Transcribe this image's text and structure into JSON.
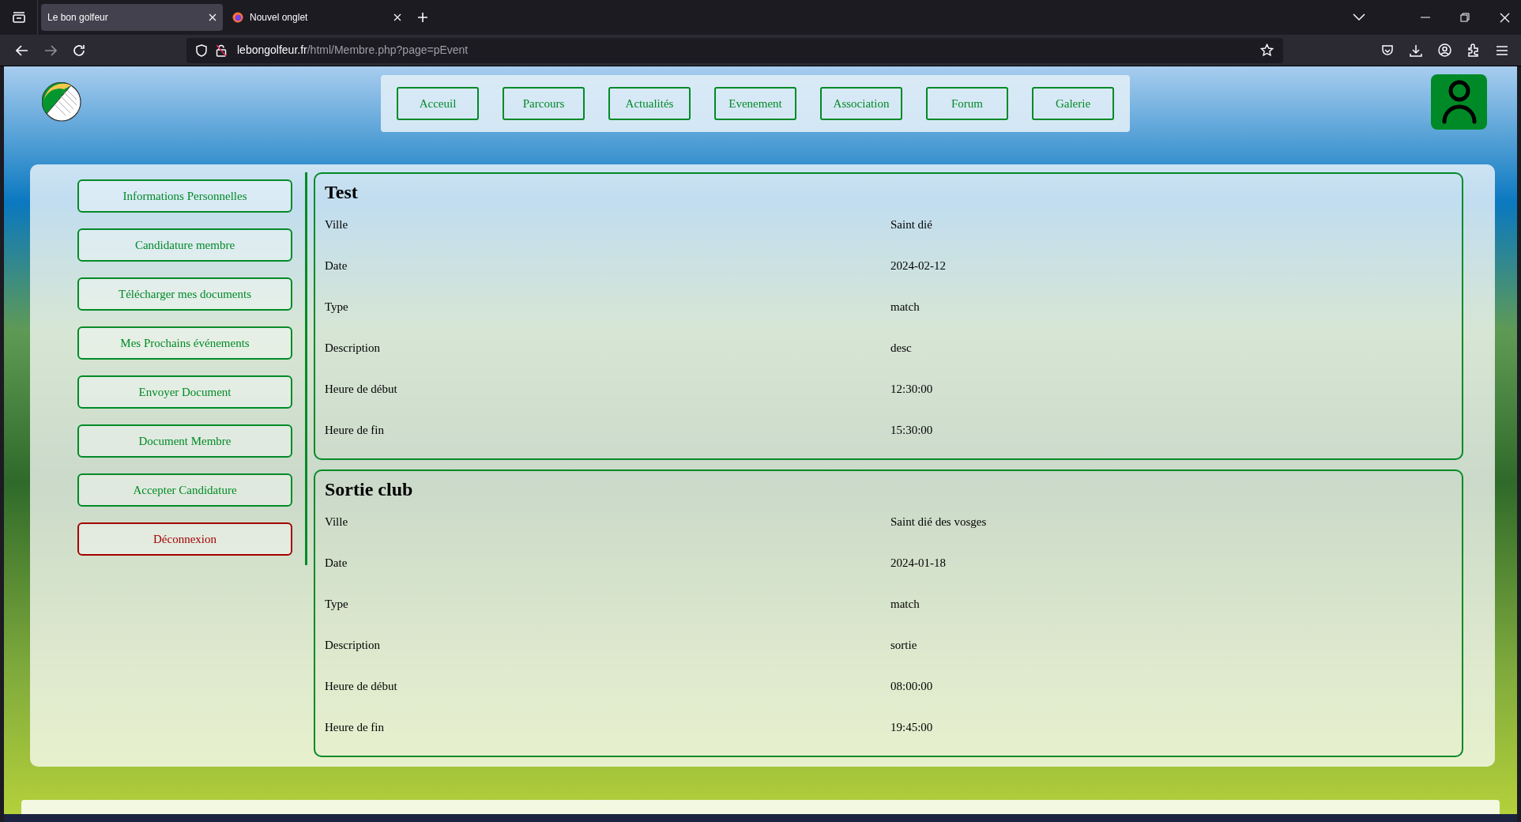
{
  "browser": {
    "tabs": [
      {
        "title": "Le bon golfeur",
        "selected": true
      },
      {
        "title": "Nouvel onglet",
        "selected": false
      }
    ],
    "url": {
      "host": "lebongolfeur.fr",
      "path": "/html/Membre.php?page=pEvent"
    }
  },
  "nav": [
    "Acceuil",
    "Parcours",
    "Actualités",
    "Evenement",
    "Association",
    "Forum",
    "Galerie"
  ],
  "sidebar": [
    {
      "label": "Informations Personnelles",
      "kind": "normal"
    },
    {
      "label": "Candidature membre",
      "kind": "normal"
    },
    {
      "label": "Télécharger mes documents",
      "kind": "normal"
    },
    {
      "label": "Mes Prochains événements",
      "kind": "normal"
    },
    {
      "label": "Envoyer Document",
      "kind": "normal"
    },
    {
      "label": "Document Membre",
      "kind": "normal"
    },
    {
      "label": "Accepter Candidature",
      "kind": "normal"
    },
    {
      "label": "Déconnexion",
      "kind": "danger"
    }
  ],
  "events": [
    {
      "title": "Test",
      "fields": [
        {
          "label": "Ville",
          "value": "Saint dié"
        },
        {
          "label": "Date",
          "value": "2024-02-12"
        },
        {
          "label": "Type",
          "value": "match"
        },
        {
          "label": "Description",
          "value": "desc"
        },
        {
          "label": "Heure de début",
          "value": "12:30:00"
        },
        {
          "label": "Heure de fin",
          "value": "15:30:00"
        }
      ]
    },
    {
      "title": "Sortie club",
      "fields": [
        {
          "label": "Ville",
          "value": "Saint dié des vosges"
        },
        {
          "label": "Date",
          "value": "2024-01-18"
        },
        {
          "label": "Type",
          "value": "match"
        },
        {
          "label": "Description",
          "value": "sortie"
        },
        {
          "label": "Heure de début",
          "value": "08:00:00"
        },
        {
          "label": "Heure de fin",
          "value": "19:45:00"
        }
      ]
    }
  ]
}
